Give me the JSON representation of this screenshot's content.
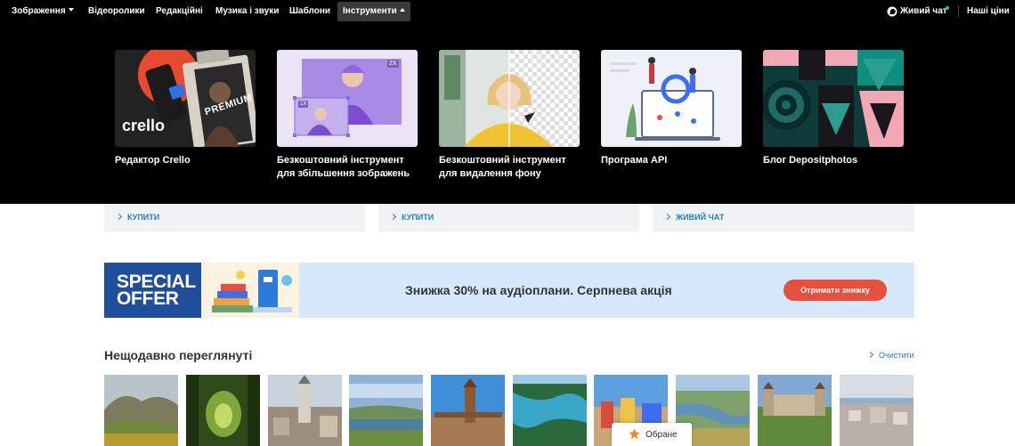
{
  "nav": {
    "items": [
      "Зображення",
      "Відеоролики",
      "Редакційні",
      "Музика і звуки",
      "Шаблони",
      "Інструменти"
    ],
    "live_chat": "Живий чат",
    "prices": "Наші ціни"
  },
  "tools": [
    {
      "label_lines": [
        "Редактор Crello"
      ],
      "thumb_text": "crello",
      "badge": "PREMIUM"
    },
    {
      "label_lines": [
        "Безкоштовний інструмент",
        "для збільшення зображень"
      ],
      "badge_small": "1X",
      "badge_large": "2X"
    },
    {
      "label_lines": [
        "Безкоштовний інструмент",
        "для видалення фону"
      ]
    },
    {
      "label_lines": [
        "Програма API"
      ]
    },
    {
      "label_lines": [
        "Блог Depositphotos"
      ]
    }
  ],
  "cards": [
    {
      "link": "КУПИТИ"
    },
    {
      "link": "КУПИТИ"
    },
    {
      "link": "ЖИВИЙ ЧАТ"
    }
  ],
  "banner": {
    "special_line1": "SPECIAL",
    "special_line2": "OFFER",
    "text": "Знижка 30% на аудіоплани. Серпнева акція",
    "button": "Отримати знижку"
  },
  "recent": {
    "title": "Нещодавно переглянуті",
    "clear": "Очистити"
  },
  "favorites": {
    "label": "Обране"
  },
  "colors": {
    "accent": "#1a83c7",
    "cta": "#e6503c",
    "banner_bg": "#d6e9fb",
    "special": "#1f4e9a",
    "nav_bg": "#000000"
  }
}
